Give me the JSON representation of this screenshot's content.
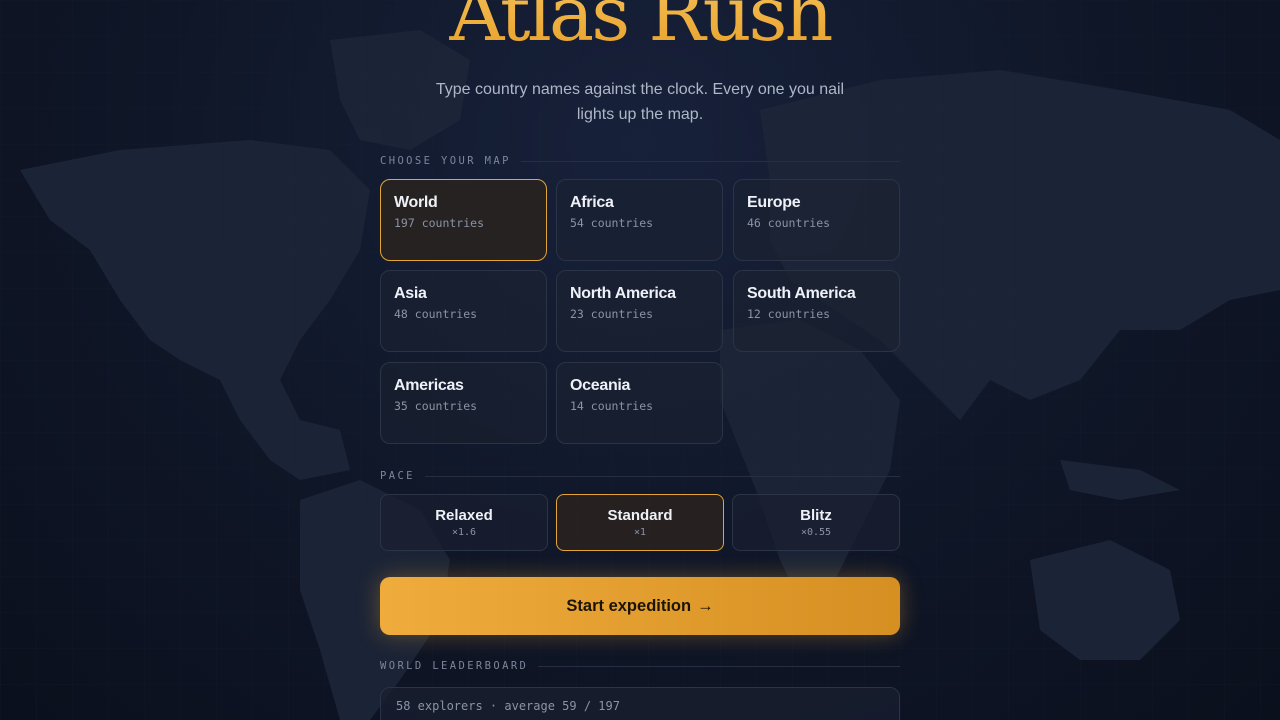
{
  "app": {
    "title": "Atlas Rush",
    "subtitle": "Type country names against the clock. Every one you nail lights up the map."
  },
  "choose_map": {
    "label": "CHOOSE YOUR MAP",
    "regions": [
      {
        "name": "World",
        "count": "197 countries",
        "selected": true
      },
      {
        "name": "Africa",
        "count": "54 countries",
        "selected": false
      },
      {
        "name": "Europe",
        "count": "46 countries",
        "selected": false
      },
      {
        "name": "Asia",
        "count": "48 countries",
        "selected": false
      },
      {
        "name": "North America",
        "count": "23 countries",
        "selected": false
      },
      {
        "name": "South America",
        "count": "12 countries",
        "selected": false
      },
      {
        "name": "Americas",
        "count": "35 countries",
        "selected": false
      },
      {
        "name": "Oceania",
        "count": "14 countries",
        "selected": false
      }
    ]
  },
  "pace": {
    "label": "PACE",
    "options": [
      {
        "name": "Relaxed",
        "multiplier": "×1.6",
        "selected": false
      },
      {
        "name": "Standard",
        "multiplier": "×1",
        "selected": true
      },
      {
        "name": "Blitz",
        "multiplier": "×0.55",
        "selected": false
      }
    ]
  },
  "start_button": {
    "label": "Start expedition",
    "icon": "arrow-right-icon",
    "glyph": "→"
  },
  "leaderboard": {
    "label": "WORLD LEADERBOARD",
    "summary": "58 explorers · average 59 / 197"
  },
  "colors": {
    "accent": "#e8a22c",
    "background": "#0f1627",
    "card": "#1c2232",
    "text": "#eef1f7",
    "muted": "#8b93a5"
  }
}
